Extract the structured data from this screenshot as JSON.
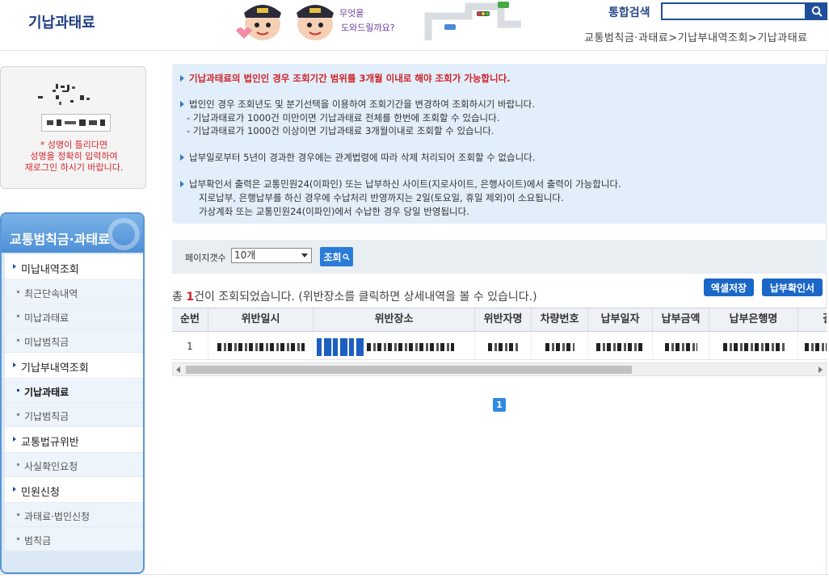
{
  "header": {
    "page_title": "기납과태료",
    "mascot_text_line1": "무엇을",
    "mascot_text_line2": "도와드릴까요?",
    "search_label": "통합검색",
    "search_value": "",
    "breadcrumb": "교통범칙금·과태료>기납부내역조회>기납과태료"
  },
  "captcha": {
    "error_lines": [
      "* 성명이 틀리다면",
      "성명을 정확히 입력하여",
      "재로그인 하시기 바랍니다."
    ]
  },
  "sidebar": {
    "title": "교통범칙금·과태료",
    "items": [
      {
        "label": "미납내역조회",
        "type": "main"
      },
      {
        "label": "최근단속내역",
        "type": "sub"
      },
      {
        "label": "미납과태료",
        "type": "sub"
      },
      {
        "label": "미납범칙금",
        "type": "sub"
      },
      {
        "label": "기납부내역조회",
        "type": "main"
      },
      {
        "label": "기납과태료",
        "type": "sub",
        "active": true
      },
      {
        "label": "기납범칙금",
        "type": "sub"
      },
      {
        "label": "교통법규위반",
        "type": "main"
      },
      {
        "label": "사실확인요청",
        "type": "sub"
      },
      {
        "label": "민원신청",
        "type": "main"
      },
      {
        "label": "과태료·법인신청",
        "type": "sub"
      },
      {
        "label": "범칙금",
        "type": "sub"
      }
    ]
  },
  "notice": {
    "line1": "기납과태료의 법인인 경우 조회기간 범위를 3개월 이내로 해야 조회가 가능합니다.",
    "line2": "법인인 경우 조회년도 및 분기선택을 이용하여 조회기간을 변경하여 조회하시기 바랍니다.",
    "line3": "- 기납과태료가 1000건 미만이면 기납과태료 전체를 한번에 조회할 수 있습니다.",
    "line4": "- 기납과태료가 1000건 이상이면 기납과태료 3개월이내로 조회할 수 있습니다.",
    "line5": "납부일로부터 5년이 경과한 경우에는 관계법령에 따라 삭제 처리되어 조회할 수 없습니다.",
    "line6": "납부확인서 출력은 교통민원24(이파인) 또는 납부하신 사이트(지로사이트, 은행사이트)에서 출력이 가능합니다.",
    "line7": "지로납부, 은행납부를 하신 경우에 수납처리 반영까지는 2일(토요일, 휴일 제외)이 소요됩니다.",
    "line8": "가상계좌 또는 교통민원24(이파인)에서 수납한 경우 당일 반영됩니다."
  },
  "filter": {
    "page_size_label": "페이지갯수",
    "page_size_value": "10개",
    "search_button": "조회"
  },
  "results": {
    "prefix": "총 ",
    "count": "1",
    "suffix": "건이 조회되었습니다. (위반장소를 클릭하면 상세내역을 볼 수 있습니다.)",
    "excel_button": "엑셀저장",
    "receipt_button": "납부확인서"
  },
  "table": {
    "columns": [
      "순번",
      "위반일시",
      "위반장소",
      "위반자명",
      "차량번호",
      "납부일자",
      "납부금액",
      "납부은행명",
      "결"
    ],
    "rows": [
      {
        "index": "1"
      }
    ]
  },
  "pagination": {
    "current": "1"
  },
  "colors": {
    "accent": "#1b67c8",
    "notice_red": "#d1232a",
    "sidebar_blue": "#4f8fd6"
  }
}
